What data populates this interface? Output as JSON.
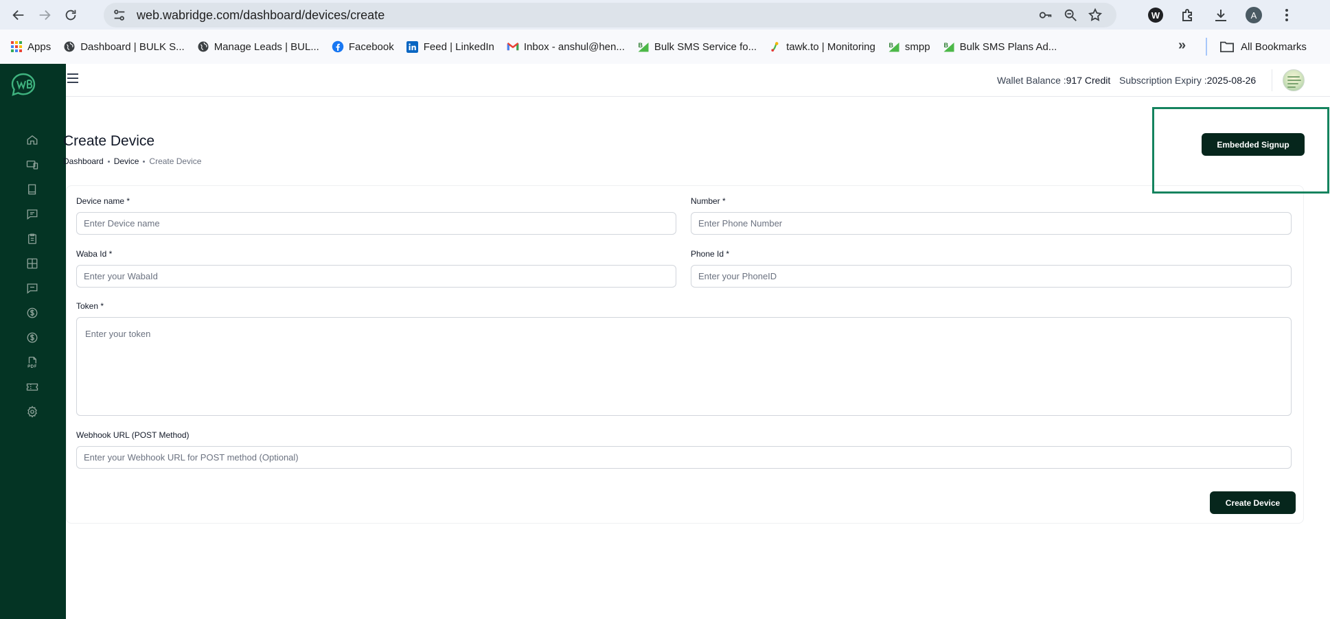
{
  "browser": {
    "url": "web.wabridge.com/dashboard/devices/create",
    "profile_initial": "A",
    "extension_letter": "W",
    "bookmarks": [
      {
        "label": "Apps",
        "icon": "apps-grid-icon"
      },
      {
        "label": "Dashboard | BULK S...",
        "icon": "globe-icon"
      },
      {
        "label": "Manage Leads | BUL...",
        "icon": "globe-icon"
      },
      {
        "label": "Facebook",
        "icon": "facebook-icon"
      },
      {
        "label": "Feed | LinkedIn",
        "icon": "linkedin-icon"
      },
      {
        "label": "Inbox - anshul@hen...",
        "icon": "gmail-icon"
      },
      {
        "label": "Bulk SMS Service fo...",
        "icon": "bulksms-icon"
      },
      {
        "label": "tawk.to | Monitoring",
        "icon": "tawk-icon"
      },
      {
        "label": "smpp",
        "icon": "bulksms-icon"
      },
      {
        "label": "Bulk SMS Plans Ad...",
        "icon": "bulksms-icon"
      }
    ],
    "all_bookmarks_label": "All Bookmarks"
  },
  "header": {
    "wallet_label": "Wallet Balance :",
    "wallet_value": "917 Credit",
    "expiry_label": "Subscription Expiry :",
    "expiry_value": "2025-08-26"
  },
  "page": {
    "title": "Create Device",
    "breadcrumb": [
      "Dashboard",
      "Device",
      "Create Device"
    ],
    "embedded_signup_label": "Embedded Signup",
    "submit_label": "Create Device"
  },
  "form": {
    "device_name": {
      "label": "Device name",
      "required": "*",
      "placeholder": "Enter Device name",
      "value": ""
    },
    "number": {
      "label": "Number",
      "required": "*",
      "placeholder": "Enter Phone Number",
      "value": ""
    },
    "waba_id": {
      "label": "Waba Id",
      "required": "*",
      "placeholder": "Enter your WabaId",
      "value": ""
    },
    "phone_id": {
      "label": "Phone Id",
      "required": "*",
      "placeholder": "Enter your PhoneID",
      "value": ""
    },
    "token": {
      "label": "Token",
      "required": "*",
      "placeholder": "Enter your token",
      "value": ""
    },
    "webhook": {
      "label": "Webhook URL (POST Method)",
      "placeholder": "Enter your Webhook URL for POST method (Optional)",
      "value": ""
    }
  },
  "sidebar": {
    "items": [
      {
        "name": "home-icon"
      },
      {
        "name": "devices-icon"
      },
      {
        "name": "book-icon"
      },
      {
        "name": "message-icon"
      },
      {
        "name": "clipboard-icon"
      },
      {
        "name": "grid-icon"
      },
      {
        "name": "chat-icon"
      },
      {
        "name": "dollar-icon"
      },
      {
        "name": "dollar-circle-icon"
      },
      {
        "name": "pdf-icon"
      },
      {
        "name": "ticket-icon"
      },
      {
        "name": "settings-icon"
      }
    ]
  },
  "colors": {
    "sidebar_bg": "#043424",
    "button_bg": "#06261c",
    "highlight_border": "#14835e",
    "chrome_bg": "#e9eef6"
  }
}
